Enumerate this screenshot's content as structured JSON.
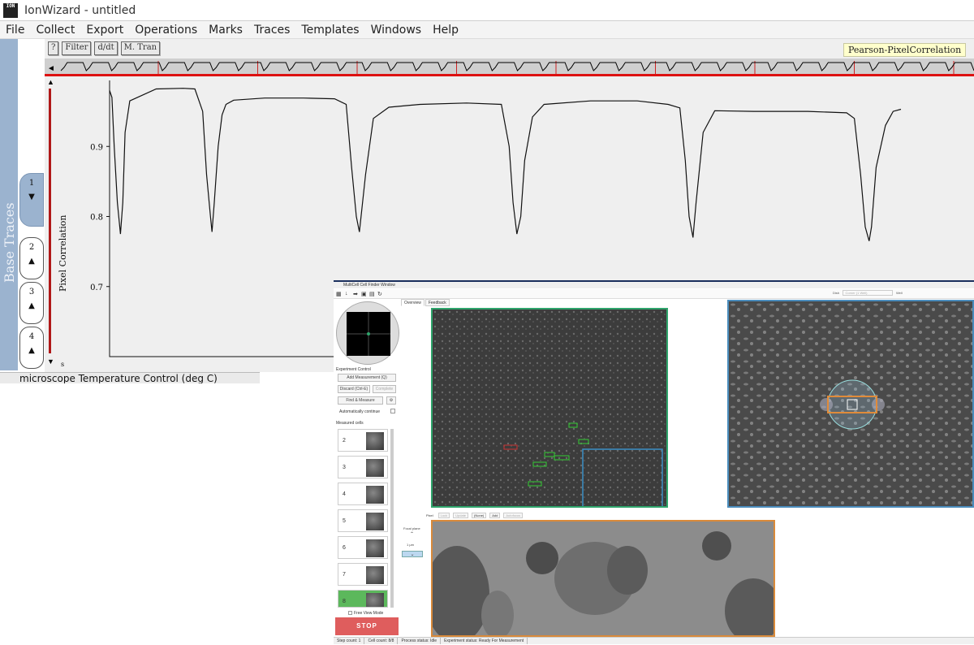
{
  "window": {
    "title": "IonWizard - untitled",
    "icon_text": "ION"
  },
  "menu": [
    "File",
    "Collect",
    "Export",
    "Operations",
    "Marks",
    "Traces",
    "Templates",
    "Windows",
    "Help"
  ],
  "sidebar": {
    "label": "Base Traces",
    "tabs": [
      {
        "label": "1",
        "arrow": "▼"
      },
      {
        "label": "2",
        "arrow": "▲"
      },
      {
        "label": "3",
        "arrow": "▲"
      },
      {
        "label": "4",
        "arrow": "▲"
      }
    ]
  },
  "toolbar": {
    "help_label": "?",
    "filter_label": "Filter",
    "deriv_label": "d/dt",
    "mtran_label": "M. Tran"
  },
  "trace_tag": "Pearson-PixelCorrelation",
  "scroll": {
    "left_arrow": "◄",
    "up_arrow": "▲",
    "down_arrow": "▼",
    "s_label": "s"
  },
  "status_main": "microscope Temperature Control (deg C)",
  "chart_data": {
    "type": "line",
    "ylabel": "Pixel Correlation",
    "yticks": [
      0.9,
      0.8,
      0.7
    ],
    "ylim": [
      0.6,
      1.0
    ],
    "series": [
      {
        "x": [
          0,
          3,
          6,
          10,
          14,
          17,
          20,
          26,
          60,
          95,
          110,
          120,
          125,
          130,
          132,
          135,
          140,
          145,
          150,
          160,
          200,
          250,
          290,
          305,
          312,
          318,
          322,
          330,
          340,
          360,
          400,
          460,
          505,
          515,
          520,
          525,
          530,
          535,
          545,
          560,
          620,
          680,
          720,
          735,
          742,
          747,
          752,
          756,
          765,
          780,
          830,
          900,
          950,
          960,
          968,
          974,
          979,
          982,
          988,
          1000,
          1010,
          1020
        ],
        "y": [
          0.98,
          0.97,
          0.9,
          0.82,
          0.775,
          0.82,
          0.92,
          0.965,
          0.982,
          0.983,
          0.982,
          0.95,
          0.86,
          0.8,
          0.778,
          0.82,
          0.9,
          0.945,
          0.96,
          0.966,
          0.969,
          0.969,
          0.968,
          0.96,
          0.87,
          0.8,
          0.778,
          0.86,
          0.94,
          0.956,
          0.96,
          0.962,
          0.96,
          0.9,
          0.82,
          0.775,
          0.8,
          0.88,
          0.942,
          0.96,
          0.965,
          0.965,
          0.96,
          0.955,
          0.88,
          0.8,
          0.77,
          0.82,
          0.92,
          0.951,
          0.95,
          0.95,
          0.948,
          0.94,
          0.86,
          0.785,
          0.765,
          0.785,
          0.87,
          0.93,
          0.95,
          0.953
        ]
      }
    ]
  },
  "multicell": {
    "title": "MultiCell Cell Finder Window",
    "tabs": [
      "Overview",
      "Feedback"
    ],
    "experiment_control": "Experiment Control",
    "add_measurement": "Add Measurement (Q)",
    "discard": "Discard (Ctrl-E)",
    "complete": "Complete",
    "find_measure": "Find & Measure",
    "auto_continue": "Automatically continue",
    "measured_cells": "Measured cells",
    "cells": [
      "2",
      "3",
      "4",
      "5",
      "6",
      "7",
      "8"
    ],
    "free_view": "Free View Mode",
    "stop": "STOP",
    "focal_plane": "Focal plane",
    "focal_value": "1 µm",
    "bottom_toolbar": [
      "Pixel",
      "Lock",
      "Update",
      "(None)",
      "Add",
      "Autofocus"
    ],
    "dish_label": "Dish",
    "dish_value": "Corner (1 Well)",
    "well_label": "Well",
    "status": [
      "Step count: 1",
      "Cell count: 8/8",
      "Process status: Idle",
      "Experiment status: Ready For Measurement"
    ]
  }
}
